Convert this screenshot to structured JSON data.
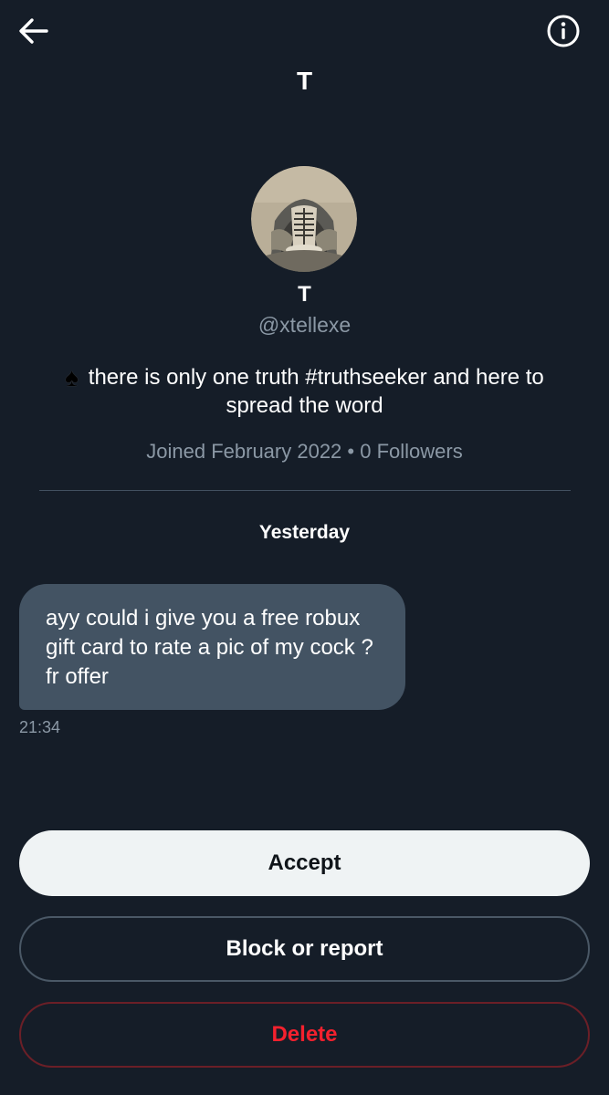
{
  "header": {
    "title": "T",
    "back_icon": "arrow-left-icon",
    "info_icon": "info-circle-icon"
  },
  "profile": {
    "name": "T",
    "handle": "@xtellexe",
    "bio_emoji": "♠",
    "bio": "there is only one truth #truthseeker and here to spread the word",
    "joined": "Joined February 2022",
    "separator": "•",
    "followers": "0 Followers"
  },
  "conversation": {
    "date_label": "Yesterday",
    "messages": [
      {
        "text": "ayy could i give you a free robux gift card to rate a pic of my cock ? fr offer",
        "time": "21:34"
      }
    ]
  },
  "actions": {
    "accept": "Accept",
    "block_or_report": "Block or report",
    "delete": "Delete"
  },
  "colors": {
    "background": "#151d28",
    "bubble": "#435363",
    "muted_text": "#8b98a5",
    "danger": "#f4212e",
    "accept_bg": "#eff3f4"
  }
}
